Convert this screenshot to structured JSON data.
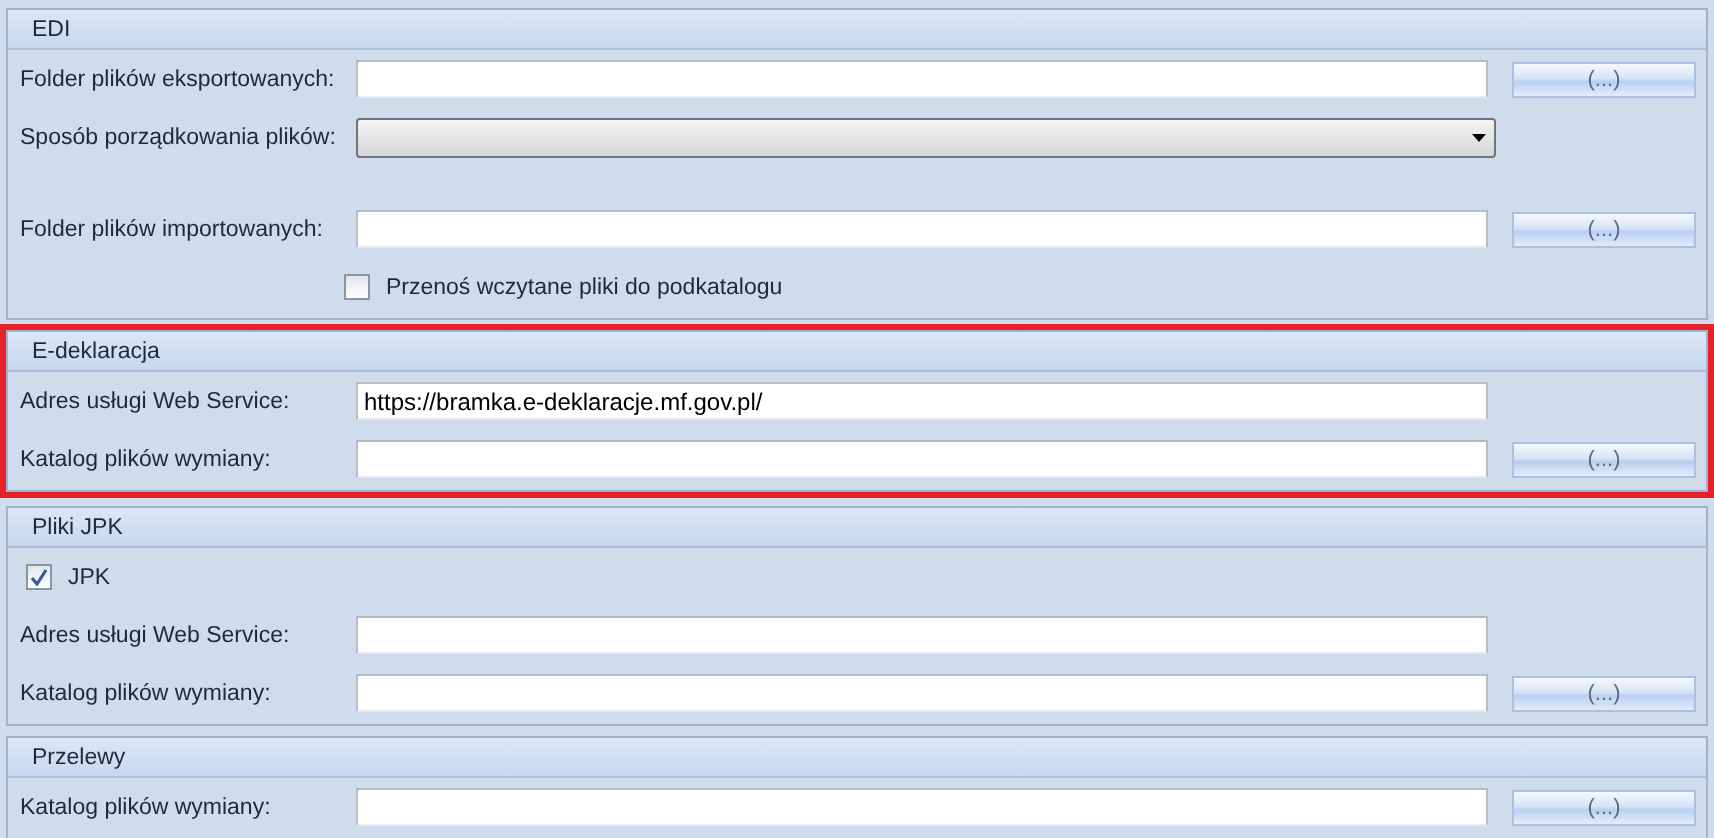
{
  "sections": [
    {
      "title": "EDI",
      "highlighted": false,
      "rows": [
        {
          "kind": "field",
          "label": "Folder plików eksportowanych:",
          "value": "",
          "browse": "(...)"
        },
        {
          "kind": "dropdown",
          "label": "Sposób porządkowania plików:",
          "value": ""
        },
        {
          "kind": "field",
          "label": "Folder plików importowanych:",
          "value": "",
          "browse": "(...)"
        },
        {
          "kind": "subcheckbox",
          "label": "Przenoś wczytane pliki do podkatalogu",
          "checked": false
        }
      ]
    },
    {
      "title": "E-deklaracja",
      "highlighted": true,
      "rows": [
        {
          "kind": "field",
          "label": "Adres usługi Web Service:",
          "value": "https://bramka.e-deklaracje.mf.gov.pl/"
        },
        {
          "kind": "field",
          "label": "Katalog plików wymiany:",
          "value": "",
          "browse": "(...)"
        }
      ]
    },
    {
      "title": "Pliki JPK",
      "highlighted": false,
      "rows": [
        {
          "kind": "checkbox",
          "label": "JPK",
          "checked": true
        },
        {
          "kind": "field",
          "label": "Adres usługi Web Service:",
          "value": ""
        },
        {
          "kind": "field",
          "label": "Katalog plików wymiany:",
          "value": "",
          "browse": "(...)"
        }
      ]
    },
    {
      "title": "Przelewy",
      "highlighted": false,
      "rows": [
        {
          "kind": "field",
          "label": "Katalog plików wymiany:",
          "value": "",
          "browse": "(...)"
        }
      ]
    }
  ]
}
